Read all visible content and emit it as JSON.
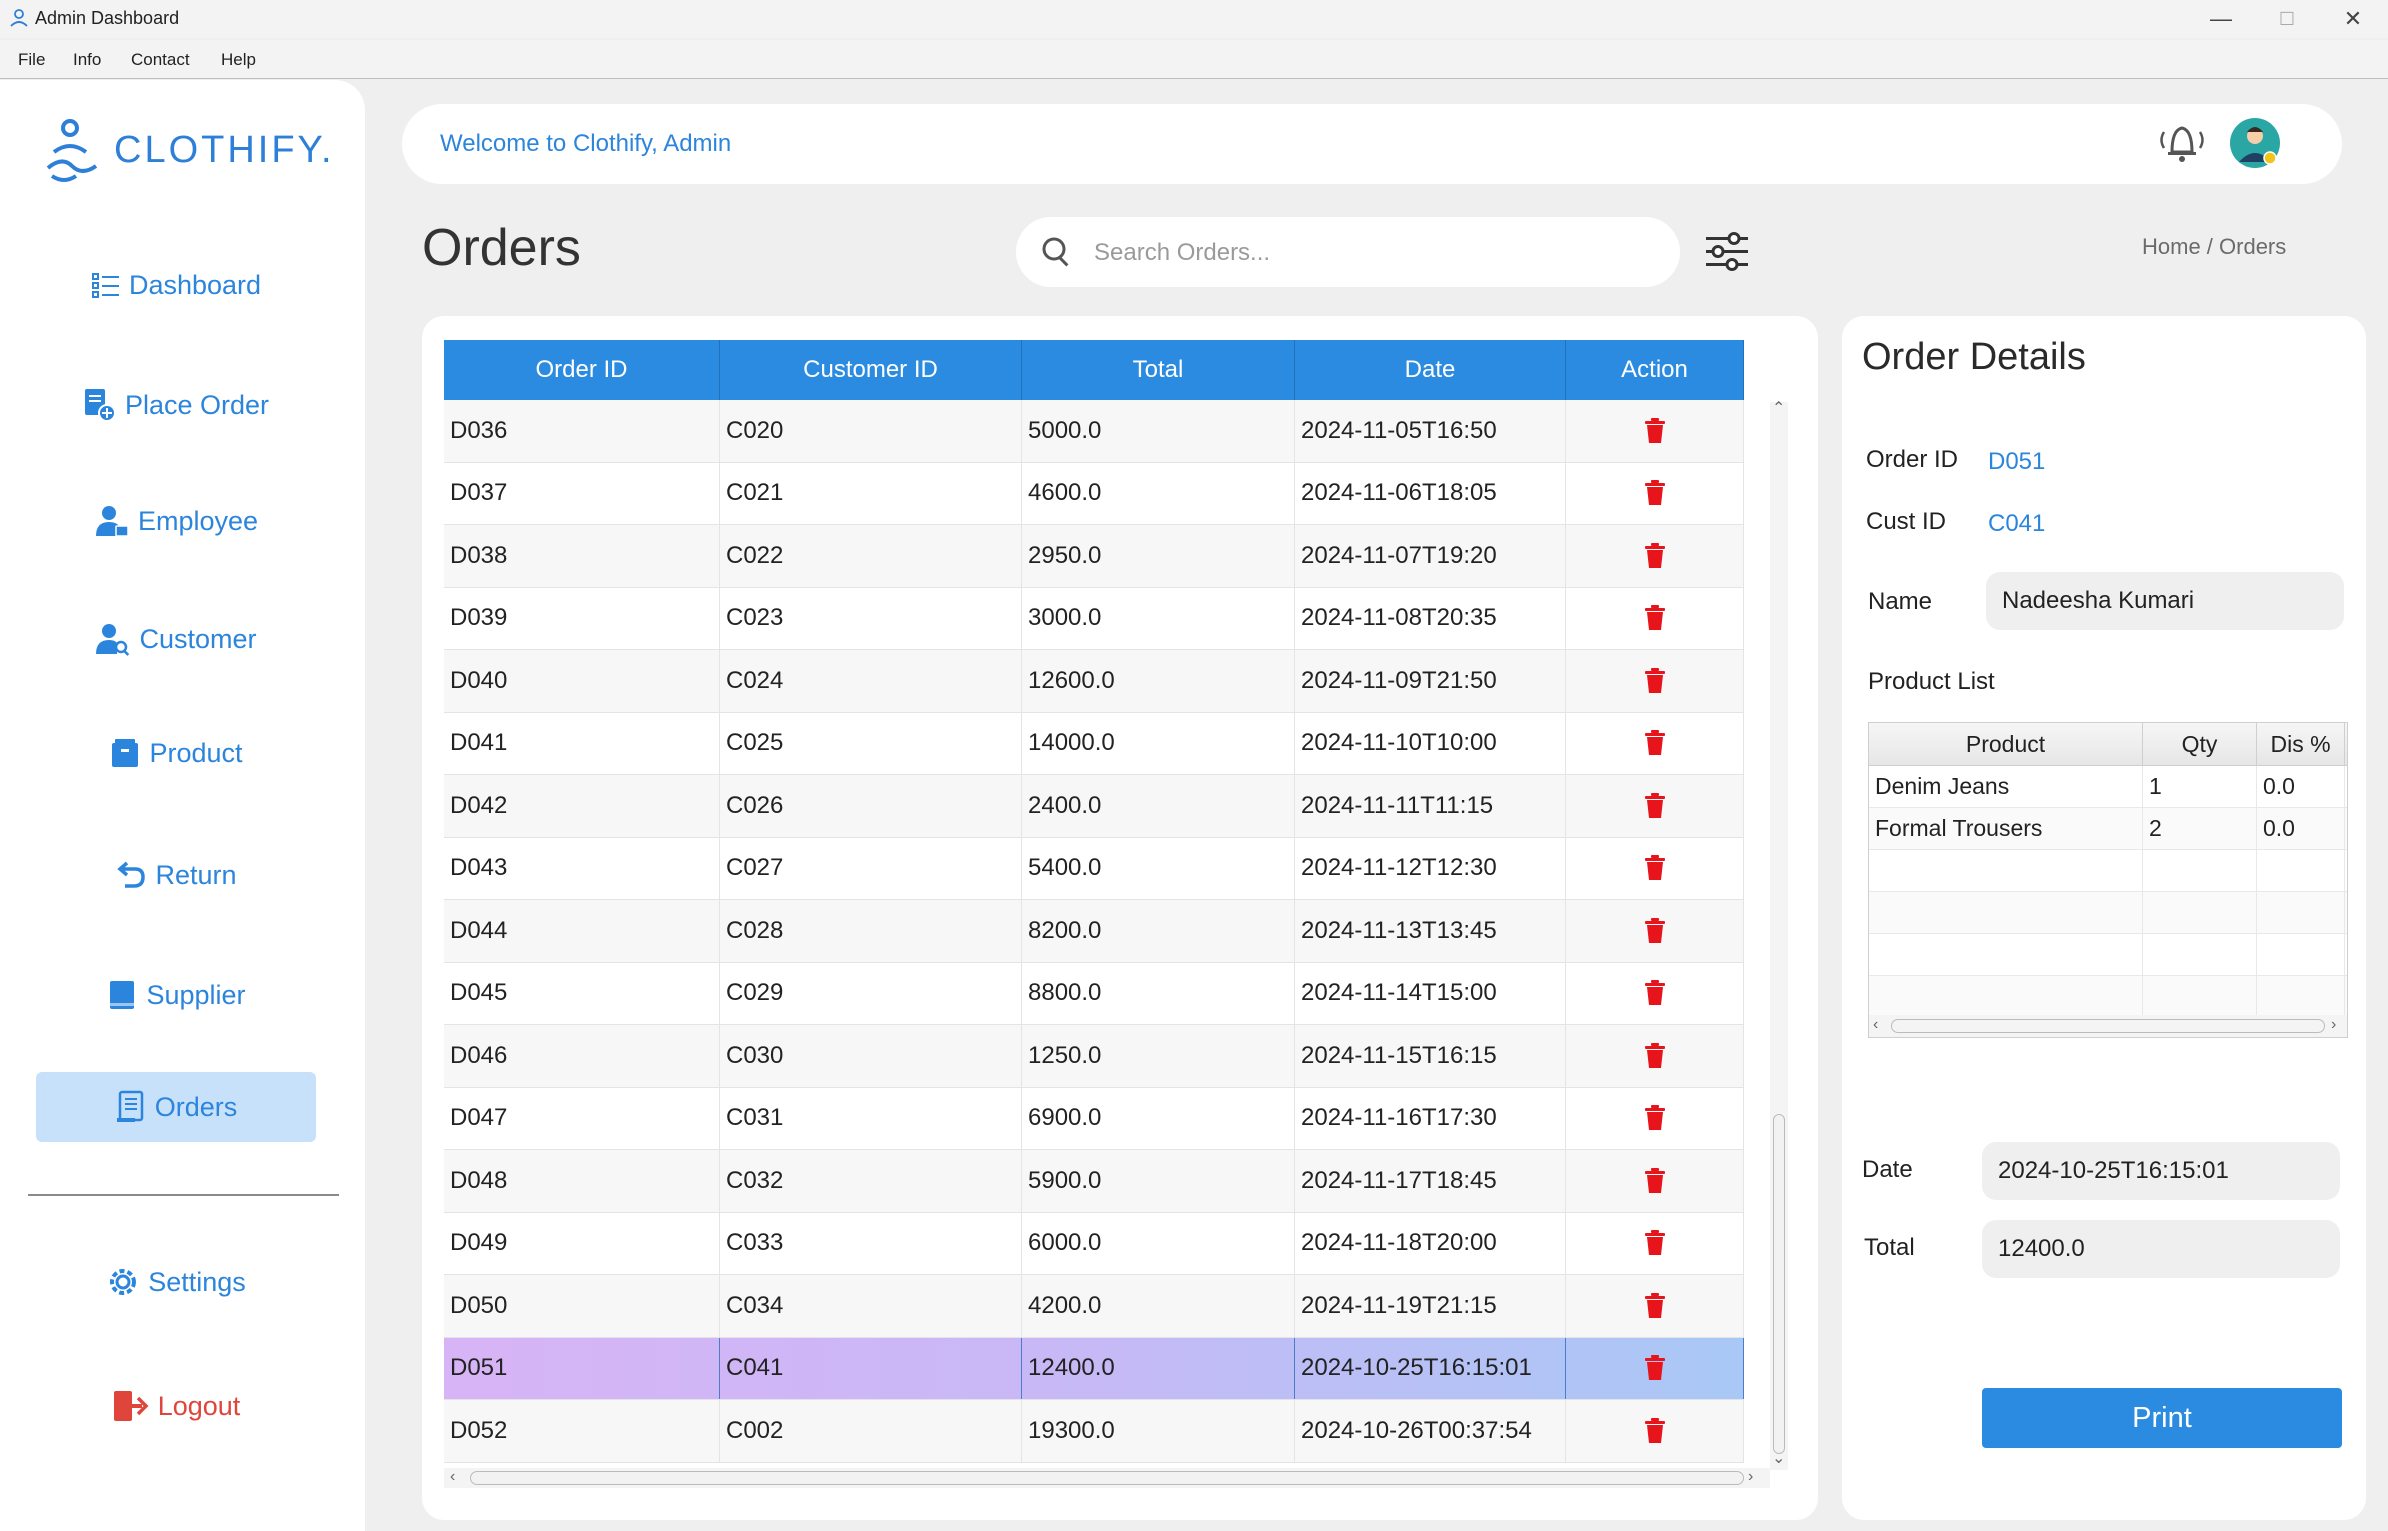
{
  "window": {
    "title": "Admin Dashboard"
  },
  "menu": {
    "file": "File",
    "info": "Info",
    "contact": "Contact",
    "help": "Help"
  },
  "sidebar": {
    "logo": "CLOTHIFY.",
    "items": [
      {
        "label": "Dashboard",
        "icon": "list-icon"
      },
      {
        "label": "Place Order",
        "icon": "order-add-icon"
      },
      {
        "label": "Employee",
        "icon": "employee-icon"
      },
      {
        "label": "Customer",
        "icon": "customer-search-icon"
      },
      {
        "label": "Product",
        "icon": "product-box-icon"
      },
      {
        "label": "Return",
        "icon": "return-arrow-icon"
      },
      {
        "label": "Supplier",
        "icon": "supplier-book-icon"
      },
      {
        "label": "Orders",
        "icon": "orders-receipt-icon",
        "active": true
      }
    ],
    "settings": "Settings",
    "logout": "Logout"
  },
  "header": {
    "welcome": "Welcome to Clothify, Admin"
  },
  "page": {
    "title": "Orders",
    "search_placeholder": "Search Orders...",
    "breadcrumb": "Home / Orders"
  },
  "orders_table": {
    "columns": [
      "Order ID",
      "Customer ID",
      "Total",
      "Date",
      "Action"
    ],
    "rows": [
      [
        "D036",
        "C020",
        "5000.0",
        "2024-11-05T16:50"
      ],
      [
        "D037",
        "C021",
        "4600.0",
        "2024-11-06T18:05"
      ],
      [
        "D038",
        "C022",
        "2950.0",
        "2024-11-07T19:20"
      ],
      [
        "D039",
        "C023",
        "3000.0",
        "2024-11-08T20:35"
      ],
      [
        "D040",
        "C024",
        "12600.0",
        "2024-11-09T21:50"
      ],
      [
        "D041",
        "C025",
        "14000.0",
        "2024-11-10T10:00"
      ],
      [
        "D042",
        "C026",
        "2400.0",
        "2024-11-11T11:15"
      ],
      [
        "D043",
        "C027",
        "5400.0",
        "2024-11-12T12:30"
      ],
      [
        "D044",
        "C028",
        "8200.0",
        "2024-11-13T13:45"
      ],
      [
        "D045",
        "C029",
        "8800.0",
        "2024-11-14T15:00"
      ],
      [
        "D046",
        "C030",
        "1250.0",
        "2024-11-15T16:15"
      ],
      [
        "D047",
        "C031",
        "6900.0",
        "2024-11-16T17:30"
      ],
      [
        "D048",
        "C032",
        "5900.0",
        "2024-11-17T18:45"
      ],
      [
        "D049",
        "C033",
        "6000.0",
        "2024-11-18T20:00"
      ],
      [
        "D050",
        "C034",
        "4200.0",
        "2024-11-19T21:15"
      ],
      [
        "D051",
        "C041",
        "12400.0",
        "2024-10-25T16:15:01"
      ],
      [
        "D052",
        "C002",
        "19300.0",
        "2024-10-26T00:37:54"
      ]
    ],
    "selected_index": 15
  },
  "details": {
    "title": "Order Details",
    "order_id_label": "Order ID",
    "order_id": "D051",
    "cust_id_label": "Cust ID",
    "cust_id": "C041",
    "name_label": "Name",
    "name": "Nadeesha Kumari",
    "product_list_label": "Product List",
    "product_columns": [
      "Product",
      "Qty",
      "Dis %"
    ],
    "products": [
      [
        "Denim Jeans",
        "1",
        "0.0"
      ],
      [
        "Formal Trousers",
        "2",
        "0.0"
      ]
    ],
    "date_label": "Date",
    "date": "2024-10-25T16:15:01",
    "total_label": "Total",
    "total": "12400.0",
    "print_label": "Print"
  },
  "colors": {
    "accent": "#2b8be0",
    "active_nav": "#c7e1fb",
    "delete": "#e8141b",
    "logout": "#e0453c"
  }
}
